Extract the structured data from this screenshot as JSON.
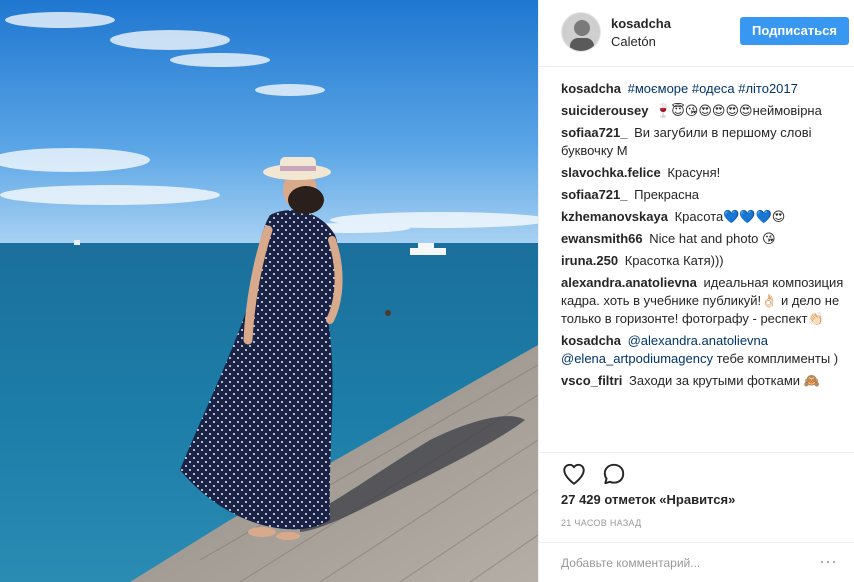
{
  "post": {
    "username": "kosadcha",
    "location": "Caletón",
    "follow_label": "Подписаться"
  },
  "comments": [
    {
      "author": "kosadcha",
      "text": "#моєморе #одеса #літо2017",
      "is_tags": true
    },
    {
      "author": "suiciderousey",
      "text": "🍷😇😘😍😍😍😍неймовірна",
      "is_tags": false
    },
    {
      "author": "sofiaa721_",
      "text": "Ви загубили в першому слові буквочку М",
      "is_tags": false
    },
    {
      "author": "slavochka.felice",
      "text": "Красуня!",
      "is_tags": false
    },
    {
      "author": "sofiaa721_",
      "text": "Прекрасна",
      "is_tags": false
    },
    {
      "author": "kzhemanovskaya",
      "text": "Красота💙💙💙😍",
      "is_tags": false
    },
    {
      "author": "ewansmith66",
      "text": "Nice hat and photo 😘",
      "is_tags": false
    },
    {
      "author": "iruna.250",
      "text": "Красотка Катя)))",
      "is_tags": false
    },
    {
      "author": "alexandra.anatolievna",
      "text": "идеальная композиция кадра. хоть в учебнике публикуй!👌🏻 и дело не только в горизонте! фотографу - респект👏🏻",
      "is_tags": false
    },
    {
      "author": "kosadcha",
      "mention1": "@alexandra.anatolievna",
      "mention2": "@elena_artpodiumagency",
      "text": "тебе комплименты )",
      "is_tags": false
    },
    {
      "author": "vsco_filtri",
      "text": "Заходи за крутыми фотками 🙈",
      "is_tags": false
    }
  ],
  "engagement": {
    "likes_label": "27 429 отметок «Нравится»",
    "time_label": "21 ЧАСОВ НАЗАД"
  },
  "add_comment": {
    "placeholder": "Добавьте комментарий...",
    "more_label": "···"
  },
  "icons": {
    "like": "heart-outline-icon",
    "comment": "speech-bubble-icon",
    "more": "more-options-icon"
  },
  "colors": {
    "accent": "#3897f0",
    "sky": "#2f8ad6",
    "sea": "#1e6f96",
    "dress": "#1a2346"
  }
}
